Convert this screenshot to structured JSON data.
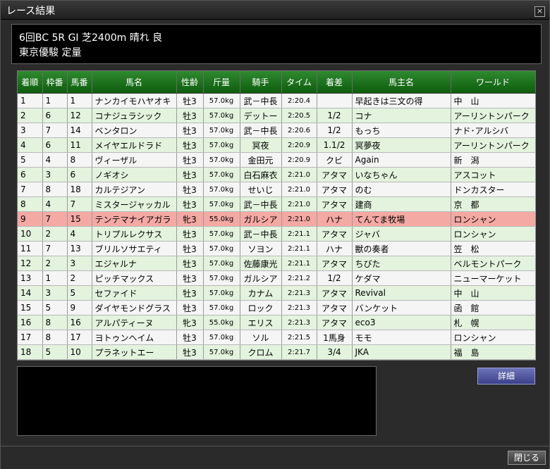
{
  "window": {
    "title": "レース結果",
    "close_glyph": "×"
  },
  "race": {
    "line1": "6回BC 5R GⅠ 芝2400m 晴れ 良",
    "line2": "東京優駿 定量"
  },
  "table": {
    "headers": [
      "着順",
      "枠番",
      "馬番",
      "馬名",
      "性齢",
      "斤量",
      "騎手",
      "タイム",
      "着差",
      "馬主名",
      "ワールド"
    ],
    "rows": [
      [
        "1",
        "1",
        "1",
        "ナンカイモハヤオキ",
        "牡3",
        "57.0kg",
        "武－中長",
        "2:20.4",
        "",
        "早起きは三文の得",
        "中　山"
      ],
      [
        "2",
        "6",
        "12",
        "コナジュラシック",
        "牡3",
        "57.0kg",
        "デットー",
        "2:20.5",
        "1/2",
        "コナ",
        "アーリントンパーク"
      ],
      [
        "3",
        "7",
        "14",
        "ベンタロン",
        "牡3",
        "57.0kg",
        "武－中長",
        "2:20.6",
        "1/2",
        "もっち",
        "ナド･アルシバ"
      ],
      [
        "4",
        "6",
        "11",
        "メイヤエルドラド",
        "牡3",
        "57.0kg",
        "冥夜",
        "2:20.9",
        "1.1/2",
        "冥夢夜",
        "アーリントンパーク"
      ],
      [
        "5",
        "4",
        "8",
        "ヴィーザル",
        "牡3",
        "57.0kg",
        "金田元",
        "2:20.9",
        "クビ",
        "Again",
        "新　潟"
      ],
      [
        "6",
        "3",
        "6",
        "ノギオシ",
        "牡3",
        "57.0kg",
        "白石麻衣",
        "2:21.0",
        "アタマ",
        "いなちゃん",
        "アスコット"
      ],
      [
        "7",
        "8",
        "18",
        "カルテジアン",
        "牡3",
        "57.0kg",
        "せいじ",
        "2:21.0",
        "アタマ",
        "のむ",
        "ドンカスター"
      ],
      [
        "8",
        "4",
        "7",
        "ミスタージャッカル",
        "牡3",
        "57.0kg",
        "武－中長",
        "2:21.0",
        "アタマ",
        "建商",
        "京　都"
      ],
      [
        "9",
        "7",
        "15",
        "テンテマナイアガラ",
        "牝3",
        "55.0kg",
        "ガルシア",
        "2:21.0",
        "ハナ",
        "てんてま牧場",
        "ロンシャン"
      ],
      [
        "10",
        "2",
        "4",
        "トリプルレクサス",
        "牡3",
        "57.0kg",
        "武－中長",
        "2:21.1",
        "アタマ",
        "ジャバ",
        "ロンシャン"
      ],
      [
        "11",
        "7",
        "13",
        "ブリルソサエティ",
        "牡3",
        "57.0kg",
        "ソヨン",
        "2:21.1",
        "ハナ",
        "獣の奏者",
        "笠　松"
      ],
      [
        "12",
        "2",
        "3",
        "エジャルナ",
        "牡3",
        "57.0kg",
        "佐藤康光",
        "2:21.1",
        "アタマ",
        "ちびた",
        "ベルモントパーク"
      ],
      [
        "13",
        "1",
        "2",
        "ピッチマックス",
        "牡3",
        "57.0kg",
        "ガルシア",
        "2:21.2",
        "1/2",
        "ケダマ",
        "ニューマーケット"
      ],
      [
        "14",
        "3",
        "5",
        "セファイド",
        "牡3",
        "57.0kg",
        "カナム",
        "2:21.3",
        "アタマ",
        "Revival",
        "中　山"
      ],
      [
        "15",
        "5",
        "9",
        "ダイヤモンドグラス",
        "牡3",
        "57.0kg",
        "ロック",
        "2:21.3",
        "アタマ",
        "バンケット",
        "函　館"
      ],
      [
        "16",
        "8",
        "16",
        "アルパティーヌ",
        "牝3",
        "55.0kg",
        "エリス",
        "2:21.3",
        "アタマ",
        "eco3",
        "札　幌"
      ],
      [
        "17",
        "8",
        "17",
        "ヨトゥンヘイム",
        "牡3",
        "57.0kg",
        "ソル",
        "2:21.5",
        "1馬身",
        "モモ",
        "ロンシャン"
      ],
      [
        "18",
        "5",
        "10",
        "プラネットエー",
        "牡3",
        "57.0kg",
        "クロム",
        "2:21.7",
        "3/4",
        "JKA",
        "福　島"
      ]
    ],
    "highlight_row": 8
  },
  "buttons": {
    "detail": "詳細",
    "close": "閉じる"
  },
  "colors": {
    "header_green": "#0d5c0d",
    "row_green": "#e3f3de",
    "row_white": "#f5f5f5",
    "highlight": "#f4a9a4"
  }
}
